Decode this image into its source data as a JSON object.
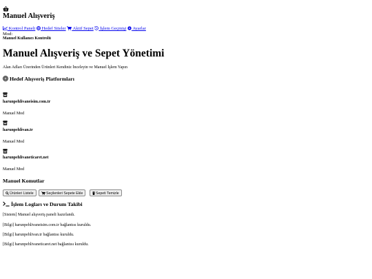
{
  "header": {
    "brand_icon": "shopping-basket-icon",
    "title": "Manuel Alışveriş",
    "nav": [
      {
        "icon": "chart-line-icon",
        "label": "Kontrol Paneli"
      },
      {
        "icon": "globe-icon",
        "label": "Hedef Siteler"
      },
      {
        "icon": "shopping-cart-icon",
        "label": "Aktif Sepet"
      },
      {
        "icon": "history-icon",
        "label": "İşlem Geçmişi"
      },
      {
        "icon": "gear-icon",
        "label": "Ayarlar"
      }
    ],
    "mode_label": "Mod:",
    "mode_value": "Manuel Kullanıcı Kontrolü"
  },
  "main": {
    "title": "Manuel Alışveriş ve Sepet Yönetimi",
    "subtitle": "Alan Adları Üzerinden Ürünleri Kendiniz İnceleyin ve Manuel İşlem Yapın"
  },
  "platforms": {
    "heading_icon": "target-icon",
    "heading": "Hedef Alışveriş Platformları",
    "items": [
      {
        "icon": "store-icon",
        "name": "harunpehlivaneisim.com.tr",
        "mode": "Manuel Mod"
      },
      {
        "icon": "store-icon",
        "name": "harunpehlivan.tr",
        "mode": "Manuel Mod"
      },
      {
        "icon": "store-icon",
        "name": "harunpehlivaneticaret.net",
        "mode": "Manuel Mod"
      }
    ]
  },
  "commands": {
    "heading": "Manuel Komutlar",
    "buttons": [
      {
        "icon": "search-icon",
        "label": "Ürünleri Listele"
      },
      {
        "icon": "cart-plus-icon",
        "label": "Seçilenleri Sepete Ekle"
      },
      {
        "icon": "trash-icon",
        "label": "Sepeti Temizle"
      }
    ]
  },
  "logs": {
    "heading_icon": "terminal-icon",
    "heading": "İşlem Logları ve Durum Takibi",
    "entries": [
      "[Sistem] Manuel alışveriş paneli hazırlandı.",
      "[Bilgi] harunpehlivaneisim.com.tr bağlantısı kuruldu.",
      "[Bilgi] harunpehlivan.tr bağlantısı kuruldu.",
      "[Bilgi] harunpehlivaneticaret.net bağlantısı kuruldu."
    ]
  }
}
